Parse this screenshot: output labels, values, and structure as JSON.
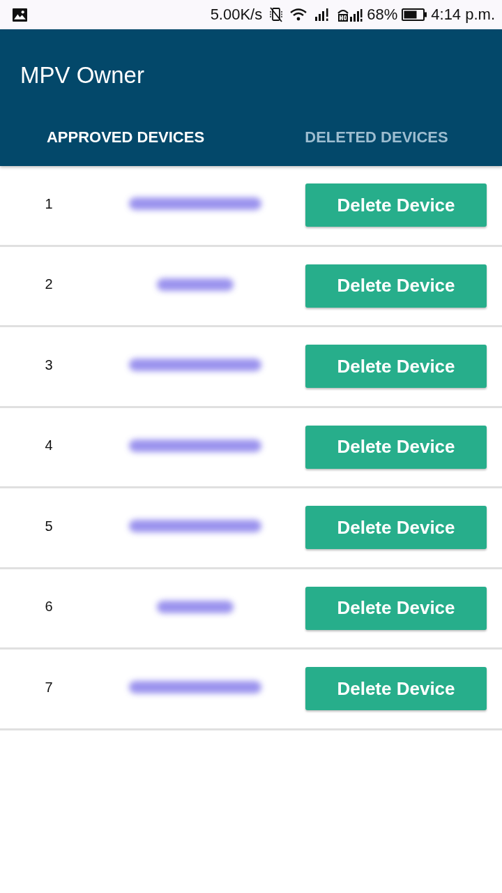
{
  "status_bar": {
    "speed": "5.00K/s",
    "battery_percent": "68%",
    "time": "4:14 p.m."
  },
  "app_bar": {
    "title": "MPV Owner"
  },
  "tabs": [
    {
      "label": "APPROVED DEVICES",
      "selected": true
    },
    {
      "label": "DELETED DEVICES",
      "selected": false
    }
  ],
  "devices": [
    {
      "number": "1",
      "kind": "long",
      "action": "Delete Device"
    },
    {
      "number": "2",
      "kind": "short",
      "action": "Delete Device"
    },
    {
      "number": "3",
      "kind": "long",
      "action": "Delete Device"
    },
    {
      "number": "4",
      "kind": "long",
      "action": "Delete Device"
    },
    {
      "number": "5",
      "kind": "long",
      "action": "Delete Device"
    },
    {
      "number": "6",
      "kind": "short",
      "action": "Delete Device"
    },
    {
      "number": "7",
      "kind": "long",
      "action": "Delete Device"
    }
  ]
}
